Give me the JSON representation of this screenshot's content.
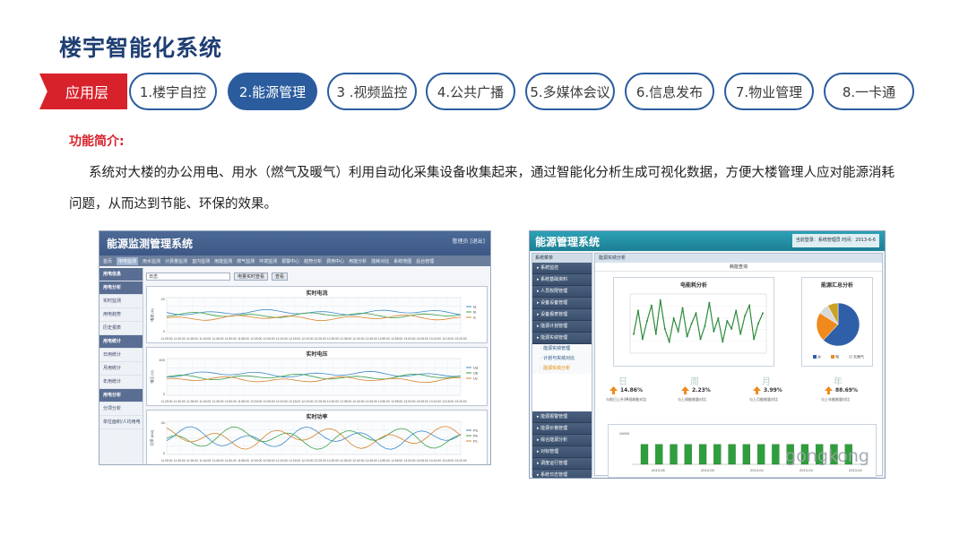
{
  "title": "楼宇智能化系统",
  "layer_tag": "应用层",
  "tabs": [
    {
      "label": "1.楼宇自控"
    },
    {
      "label": "2.能源管理"
    },
    {
      "label": "3 .视频监控"
    },
    {
      "label": "4.公共广播"
    },
    {
      "label": "5.多媒体会议"
    },
    {
      "label": "6.信息发布"
    },
    {
      "label": "7.物业管理"
    },
    {
      "label": "8.一卡通"
    }
  ],
  "intro": {
    "label": "功能简介:",
    "text": "系统对大楼的办公用电、用水（燃气及暖气）利用自动化采集设备收集起来，通过智能化分析生成可视化数据，方便大楼管理人应对能源消耗问题，从而达到节能、环保的效果。"
  },
  "left_screenshot": {
    "app_title": "能源监测管理系统",
    "user": "管理员 [退出]",
    "nav": [
      "首页",
      "用电监测",
      "用水监测",
      "计费量监测",
      "室内监测",
      "用能监测",
      "燃气监测",
      "环境监测",
      "报警中心",
      "趋势分析",
      "费用中心",
      "用能分析",
      "能耗对比",
      "系统地图",
      "后台管理"
    ],
    "sidebar": [
      {
        "label": "用电信息",
        "group": true
      },
      {
        "label": "用电分析",
        "group": true
      },
      {
        "label": "实时监测",
        "group": false
      },
      {
        "label": "用电趋势",
        "group": false
      },
      {
        "label": "历史报表",
        "group": false
      },
      {
        "label": "用电统计",
        "group": true
      },
      {
        "label": "日用统计",
        "group": false
      },
      {
        "label": "月用统计",
        "group": false
      },
      {
        "label": "年用统计",
        "group": false
      },
      {
        "label": "用电分析",
        "group": true
      },
      {
        "label": "分项分析",
        "group": false
      },
      {
        "label": "单位面积/人均用电",
        "group": false
      }
    ],
    "filter": {
      "select": "日志",
      "button1": "电量实时查看",
      "button2": "查看"
    },
    "charts": [
      {
        "title": "实时电流",
        "ylabel": "电流 (A)",
        "series": [
          "Ia",
          "Ib",
          "Ic"
        ],
        "ytick_top": "20",
        "ytick_bottom": "0"
      },
      {
        "title": "实时电压",
        "ylabel": "电压 (V)",
        "series": [
          "Ua",
          "Ub",
          "Uc"
        ],
        "ytick_top": "400",
        "ytick_bottom": "0"
      },
      {
        "title": "实时功率",
        "ylabel": "功率 (kW)",
        "series": [
          "Pa",
          "Pb",
          "Pc"
        ],
        "ytick_top": "30",
        "ytick_bottom": "0"
      }
    ],
    "x_ticks": [
      "11:25:00",
      "11:30:00",
      "11:35:00",
      "11:40:00",
      "11:45:00",
      "11:50:00",
      "11:55:00",
      "12:00:00",
      "12:05:00",
      "12:10:00",
      "12:15:00",
      "12:20:00",
      "12:25:00",
      "12:30:00",
      "12:35:00",
      "12:40:00",
      "12:45:00",
      "12:50:00",
      "12:55:00",
      "13:00:00",
      "13:05:00",
      "13:10:00",
      "13:15:00",
      "13:20:00"
    ],
    "colors": {
      "s1": "#3d8ac9",
      "s2": "#3aa24a",
      "s3": "#d9832b"
    }
  },
  "right_screenshot": {
    "app_title": "能源管理系统",
    "info": "当前登录：系统管理员  时间：2013-6-6",
    "sidebar_header": "系统菜单",
    "menu_top": [
      "系统监控",
      "系统基础资料",
      "人员权限管理",
      "设备设备管理",
      "设备报表管理",
      "能源计划管理",
      "能源实绩管理"
    ],
    "menu_sub": [
      {
        "label": "能源实绩管理",
        "on": false
      },
      {
        "label": "计划与实绩对比",
        "on": false
      },
      {
        "label": "能源实绩分析",
        "on": true
      }
    ],
    "menu_bottom": [
      "能源报警管理",
      "能源价格管理",
      "综合能源分析",
      "对标管理",
      "调度运行管理",
      "系统日志管理"
    ],
    "tab": "能源实绩分析",
    "crumb": "耗能查询",
    "line_chart_title": "电能耗分析",
    "pie_chart_title": "能源汇总分析",
    "pie_legend": [
      "水",
      "电",
      "天然气"
    ],
    "colors": {
      "line": "#2e8b3d",
      "water": "#2f5fa8",
      "electric": "#f08a1c",
      "gas": "#d9d9d9",
      "bar": "#2f9e3c"
    },
    "stats": [
      {
        "period": "日",
        "percent": "14.86%",
        "caption": "与前日上升/降低耗能对比",
        "dir": "up"
      },
      {
        "period": "周",
        "percent": "2.23%",
        "caption": "与上周能耗量对比",
        "dir": "up"
      },
      {
        "period": "月",
        "percent": "3.99%",
        "caption": "与上月能耗量对比",
        "dir": "up"
      },
      {
        "period": "年",
        "percent": "88.69%",
        "caption": "与上年能耗量对比",
        "dir": "up"
      }
    ],
    "bar_years": [
      "2013-06",
      "2013-05",
      "2013-04",
      "2013-03",
      "2013-02"
    ],
    "bar_ymax": "10000",
    "watermark": "gongkong"
  }
}
